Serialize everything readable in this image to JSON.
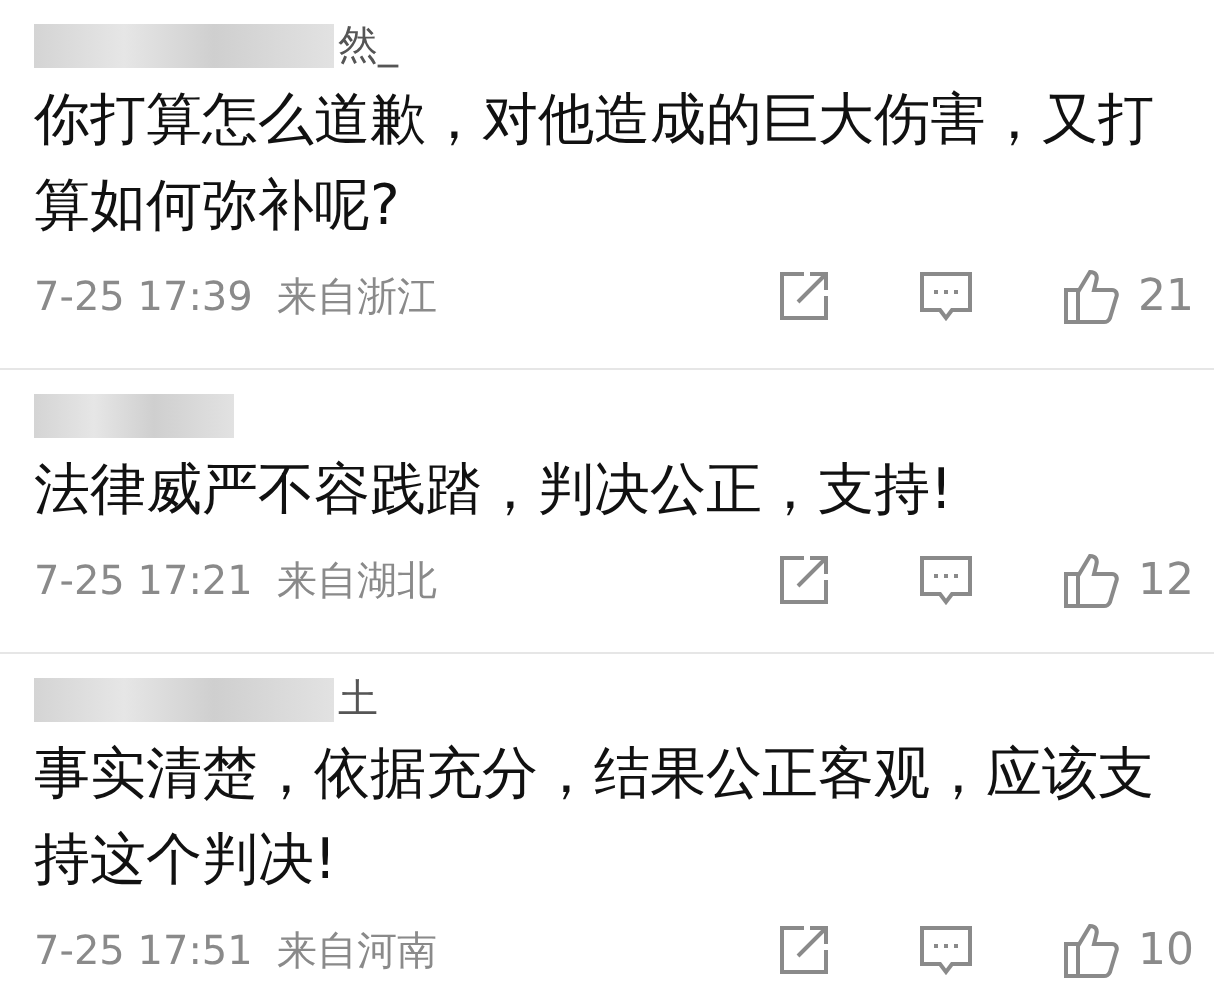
{
  "comments": [
    {
      "username_visible": "然_",
      "text": "你打算怎么道歉，对他造成的巨大伤害，又打算如何弥补呢?",
      "time": "7-25 17:39",
      "location": "来自浙江",
      "likes": "21"
    },
    {
      "text": "法律威严不容践踏，判决公正，支持!",
      "time": "7-25 17:21",
      "location": "来自湖北",
      "likes": "12"
    },
    {
      "username_visible": "土",
      "text": "事实清楚，依据充分，结果公正客观，应该支持这个判决!",
      "time": "7-25 17:51",
      "location": "来自河南",
      "likes": "10"
    }
  ]
}
